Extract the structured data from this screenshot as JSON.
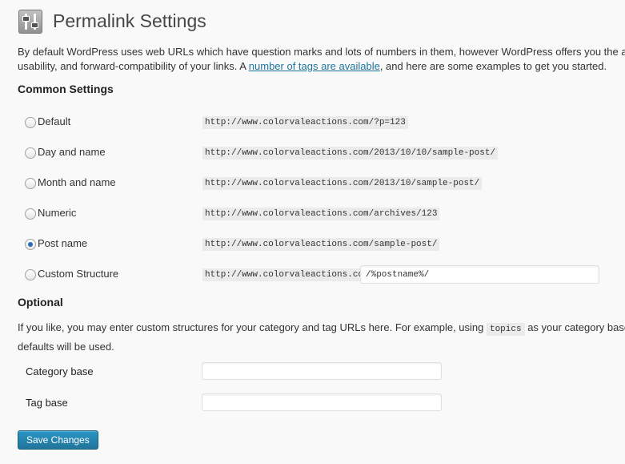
{
  "header": {
    "title": "Permalink Settings"
  },
  "intro": {
    "text_before": "By default WordPress uses web URLs which have question marks and lots of numbers in them, however WordPress offers you the ability to create a custom URL structure for your permalinks and archives. This can improve the aesthetics,",
    "line2_before": "usability, and forward-compatibility of your links. A ",
    "link_text": "number of tags are available",
    "line2_after": ", and here are some examples to get you started."
  },
  "common": {
    "heading": "Common Settings",
    "options": [
      {
        "label": "Default",
        "example": "http://www.colorvaleactions.com/?p=123",
        "selected": false
      },
      {
        "label": "Day and name",
        "example": "http://www.colorvaleactions.com/2013/10/10/sample-post/",
        "selected": false
      },
      {
        "label": "Month and name",
        "example": "http://www.colorvaleactions.com/2013/10/sample-post/",
        "selected": false
      },
      {
        "label": "Numeric",
        "example": "http://www.colorvaleactions.com/archives/123",
        "selected": false
      },
      {
        "label": "Post name",
        "example": "http://www.colorvaleactions.com/sample-post/",
        "selected": true
      },
      {
        "label": "Custom Structure",
        "example": "http://www.colorvaleactions.com",
        "selected": false,
        "value": "/%postname%/"
      }
    ]
  },
  "optional": {
    "heading": "Optional",
    "text_before": "If you like, you may enter custom structures for your category and tag URLs here. For example, using ",
    "code": "topics",
    "text_after": " as your category base would m",
    "line2": "defaults will be used.",
    "category_label": "Category base",
    "category_value": "",
    "tag_label": "Tag base",
    "tag_value": ""
  },
  "actions": {
    "save_label": "Save Changes"
  },
  "colors": {
    "accent": "#21759b",
    "title": "#464646",
    "background": "#f9f9f9"
  },
  "icons": {
    "page_icon": "sliders-icon"
  }
}
